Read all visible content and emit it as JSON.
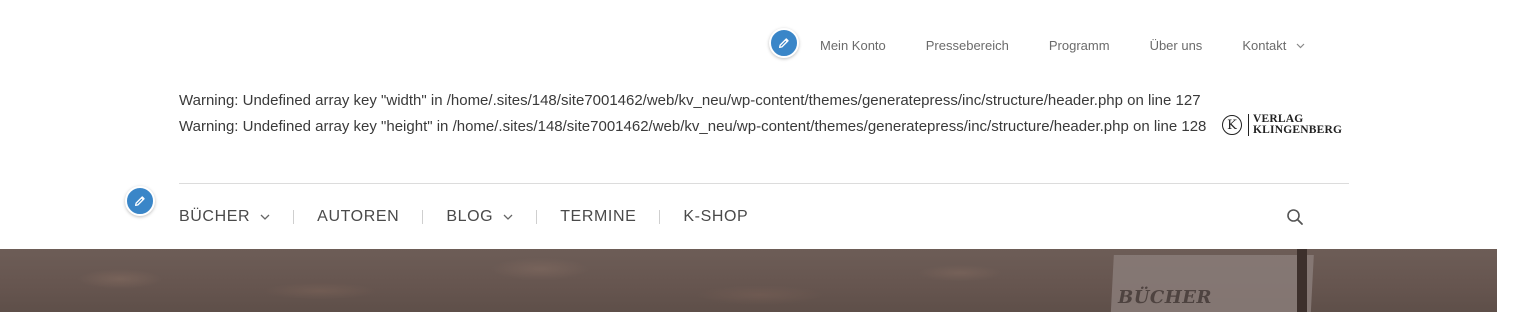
{
  "top_nav": {
    "items": [
      {
        "label": "Mein Konto"
      },
      {
        "label": "Pressebereich"
      },
      {
        "label": "Programm"
      },
      {
        "label": "Über uns"
      },
      {
        "label": "Kontakt",
        "has_dropdown": true
      }
    ]
  },
  "warning": {
    "text": "Warning: Undefined array key \"width\" in /home/.sites/148/site7001462/web/kv_neu/wp-content/themes/generatepress/inc/structure/header.php on line 127 Warning: Undefined array key \"height\" in /home/.sites/148/site7001462/web/kv_neu/wp-content/themes/generatepress/inc/structure/header.php on line 128"
  },
  "logo": {
    "mark": "K",
    "line1": "VERLAG",
    "line2": "KLINGENBERG"
  },
  "main_nav": {
    "items": [
      {
        "label": "BÜCHER",
        "has_dropdown": true
      },
      {
        "label": "AUTOREN",
        "has_dropdown": false
      },
      {
        "label": "BLOG",
        "has_dropdown": true
      },
      {
        "label": "TERMINE",
        "has_dropdown": false
      },
      {
        "label": "K-SHOP",
        "has_dropdown": false
      }
    ]
  },
  "hero": {
    "sign_text": "BÜCHER"
  },
  "icons": {
    "edit": "pencil-icon",
    "search": "search-icon",
    "dropdown": "chevron-down-icon"
  },
  "colors": {
    "edit_badge": "#3a86c8",
    "text": "#3a3a3a",
    "nav_text": "#4a4a4a",
    "divider": "#dcdcdc"
  }
}
